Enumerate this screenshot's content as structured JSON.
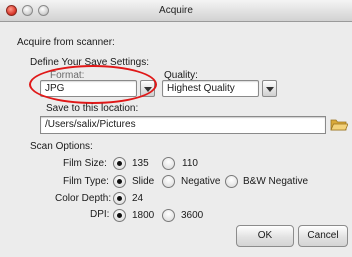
{
  "window": {
    "title": "Acquire"
  },
  "section": {
    "heading": "Acquire from scanner:"
  },
  "save_settings": {
    "heading": "Define Your Save Settings:",
    "format_label": "Format:",
    "format_value": "JPG",
    "quality_label": "Quality:",
    "quality_value": "Highest Quality",
    "location_label": "Save to this location:",
    "location_value": "/Users/salix/Pictures"
  },
  "scan_options": {
    "heading": "Scan Options:",
    "film_size": {
      "label": "Film Size:",
      "options": [
        "135",
        "110"
      ],
      "selected": "135"
    },
    "film_type": {
      "label": "Film Type:",
      "options": [
        "Slide",
        "Negative",
        "B&W Negative"
      ],
      "selected": "Slide"
    },
    "color_depth": {
      "label": "Color Depth:",
      "options": [
        "24"
      ],
      "selected": "24"
    },
    "dpi": {
      "label": "DPI:",
      "options": [
        "1800",
        "3600"
      ],
      "selected": "1800"
    }
  },
  "buttons": {
    "ok": "OK",
    "cancel": "Cancel"
  },
  "icons": {
    "folder": "folder-icon"
  },
  "colors": {
    "highlight": "#e01818",
    "folder": "#e8c25a"
  }
}
